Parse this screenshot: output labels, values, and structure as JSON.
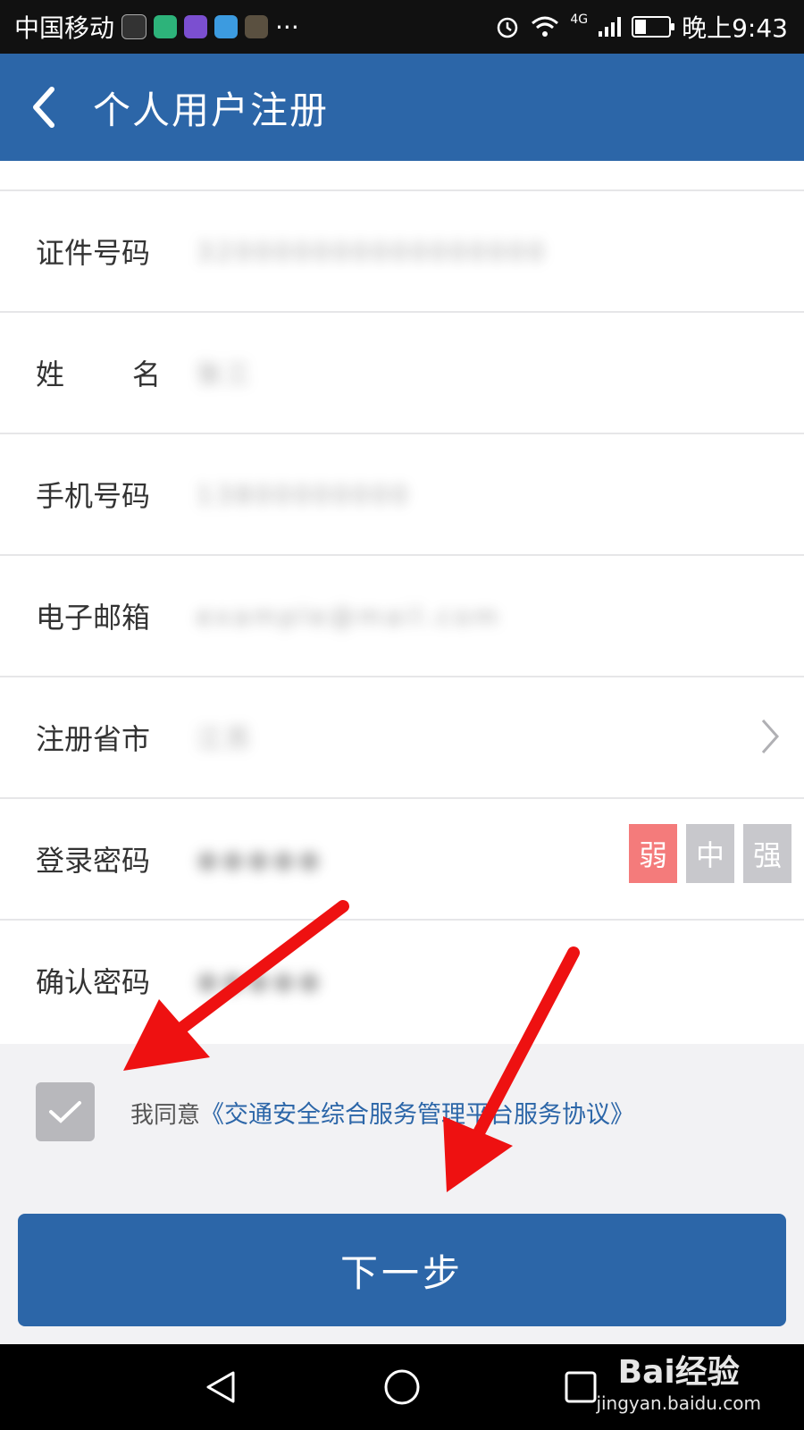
{
  "status_bar": {
    "carrier": "中国移动",
    "dots": "···",
    "network": "4G",
    "time": "晚上9:43"
  },
  "header": {
    "back_icon": "chevron-left-icon",
    "title": "个人用户注册"
  },
  "form": {
    "id_number": {
      "label": "证件号码",
      "value": "320000000000000000"
    },
    "name": {
      "label_chars": [
        "姓",
        "名"
      ],
      "value": "张三"
    },
    "phone": {
      "label": "手机号码",
      "value": "13800000000"
    },
    "email": {
      "label": "电子邮箱",
      "value": "example@mail.com"
    },
    "province": {
      "label": "注册省市",
      "value": "江苏"
    },
    "password": {
      "label": "登录密码",
      "value": "●●●●●"
    },
    "password_strength": {
      "weak": "弱",
      "medium": "中",
      "strong": "强"
    },
    "confirm_password": {
      "label": "确认密码",
      "value": "●●●●●"
    }
  },
  "agreement": {
    "prefix": "我同意",
    "link": "《交通安全综合服务管理平台服务协议》"
  },
  "next_button": "下一步",
  "watermark": {
    "brand": "Bai经验",
    "url": "jingyan.baidu.com"
  },
  "colors": {
    "primary": "#2c66a8",
    "strength_weak": "#f47b7b",
    "strength_inactive": "#c8c8cc",
    "annotation_arrow": "#ee1111"
  }
}
